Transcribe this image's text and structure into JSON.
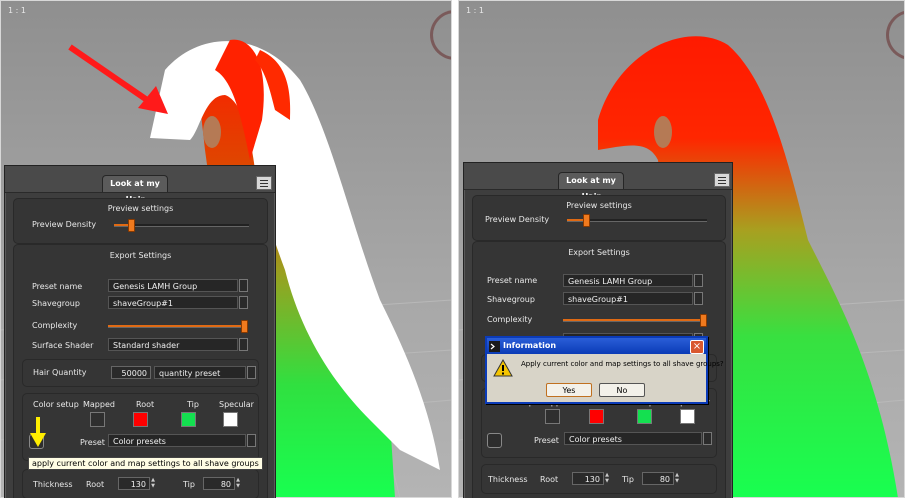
{
  "viewport_label": "1 : 1",
  "left": {
    "panel": {
      "tab_label": "Look at my Hair",
      "preview_header": "Preview settings",
      "preview_density_label": "Preview Density",
      "export_header": "Export Settings",
      "preset_name_label": "Preset name",
      "preset_name_value": "Genesis LAMH Group",
      "shavegroup_label": "Shavegroup",
      "shavegroup_value": "shaveGroup#1",
      "complexity_label": "Complexity",
      "surface_shader_label": "Surface Shader",
      "surface_shader_value": "Standard shader",
      "hair_quantity_label": "Hair Quantity",
      "hair_quantity_value": "50000",
      "quantity_preset_value": "quantity preset",
      "color_setup_label": "Color setup",
      "mapped_label": "Mapped",
      "root_label": "Root",
      "tip_label": "Tip",
      "specular_label": "Specular",
      "preset_label": "Preset",
      "color_presets_value": "Color presets",
      "tooltip_text": "apply current color and map settings to all shave groups",
      "thickness_label": "Thickness",
      "root_spin_label": "Root",
      "root_thickness": "130",
      "tip_spin_label": "Tip",
      "tip_thickness": "80"
    }
  },
  "right": {
    "panel": {
      "tab_label": "Look at my Hair",
      "preview_header": "Preview settings",
      "preview_density_label": "Preview Density",
      "export_header": "Export Settings",
      "preset_name_label": "Preset name",
      "preset_name_value": "Genesis LAMH Group",
      "shavegroup_label": "Shavegroup",
      "shavegroup_value": "shaveGroup#1",
      "complexity_label": "Complexity",
      "color_setup_label": "Color setup",
      "mapped_label": "Mapped",
      "root_label": "Root",
      "tip_label": "Tip",
      "specular_label": "Specular",
      "preset_label": "Preset",
      "color_presets_value": "Color presets",
      "thickness_label": "Thickness",
      "root_spin_label": "Root",
      "root_thickness": "130",
      "tip_spin_label": "Tip",
      "tip_thickness": "80"
    },
    "dialog": {
      "title": "Information",
      "message": "Apply current color and map settings to all shave groups?",
      "yes_label": "Yes",
      "no_label": "No"
    }
  },
  "sliders": {
    "preview_density": 0.13,
    "complexity": 1.0
  },
  "colors": {
    "root": "#ff0000",
    "tip": "#14e050",
    "specular": "#ffffff",
    "mapped": "#2f2f2f",
    "accent": "#e8761c",
    "dialog_title": "#0a3bb6",
    "annotation_red": "#ff1a1a",
    "annotation_yellow": "#ffee00"
  },
  "icons": {
    "menu": "panel-menu-icon",
    "warning": "warning-icon",
    "close": "close-icon",
    "app": "terminal-icon"
  }
}
